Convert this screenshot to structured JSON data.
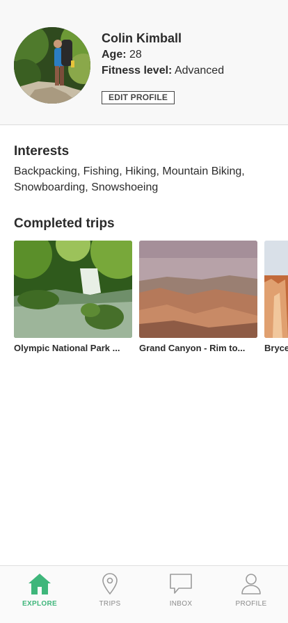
{
  "profile": {
    "name": "Colin Kimball",
    "age_label": "Age:",
    "age_value": "28",
    "fitness_label": "Fitness level:",
    "fitness_value": "Advanced",
    "edit_button": "EDIT PROFILE"
  },
  "interests": {
    "title": "Interests",
    "text": "Backpacking, Fishing, Hiking, Mountain Biking, Snowboarding, Snowshoeing"
  },
  "completed_trips": {
    "title": "Completed trips",
    "items": [
      {
        "name": "Olympic National Park ..."
      },
      {
        "name": "Grand Canyon - Rim to..."
      },
      {
        "name": "Bryce"
      }
    ]
  },
  "tabbar": {
    "tabs": [
      {
        "label": "EXPLORE",
        "icon": "home-icon",
        "active": true
      },
      {
        "label": "TRIPS",
        "icon": "map-pin-icon",
        "active": false
      },
      {
        "label": "INBOX",
        "icon": "chat-bubble-icon",
        "active": false
      },
      {
        "label": "PROFILE",
        "icon": "user-icon",
        "active": false
      }
    ],
    "active_color": "#3fb67b",
    "inactive_color": "#8a8a8a"
  }
}
